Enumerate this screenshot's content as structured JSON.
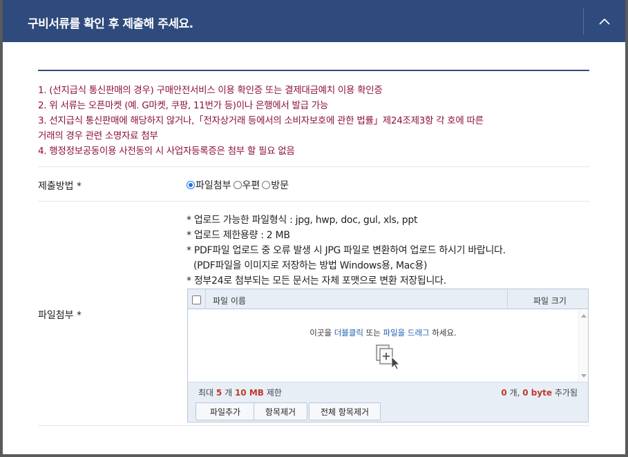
{
  "header": {
    "title": "구비서류를 확인 후 제출해 주세요."
  },
  "notices": [
    "1. (선지급식 통신판매의 경우) 구매안전서비스 이용 확인증 또는 결제대금예치 이용 확인증",
    "2. 위 서류는 오픈마켓 (예. G마켓, 쿠팡, 11번가 등)이나 은행에서 발급 가능",
    "3. 선지급식 통신판매에 해당하지 않거나,「전자상거래 등에서의 소비자보호에 관한 법률」제24조제3항 각 호에 따른",
    "거래의 경우 관련 소명자료 첨부",
    "4. 행정정보공동이용 사전동의 시 사업자등록증은 첨부 할 필요 없음"
  ],
  "submit_method": {
    "label": "제출방법 *",
    "options": [
      "파일첨부",
      "우편",
      "방문"
    ],
    "selected": "파일첨부"
  },
  "file_attach": {
    "label": "파일첨부 *",
    "info": [
      "* 업로드 가능한 파일형식 : jpg, hwp, doc, gul, xls, ppt",
      "* 업로드 제한용량 : 2 MB",
      "* PDF파일 업로드 중 오류 발생 시 JPG 파일로 변환하여 업로드 하시기 바랍니다.",
      "(PDF파일을 이미지로 저장하는 방법  Windows용, Mac용)",
      "* 정부24로 첨부되는 모든 문서는 자체 포맷으로 변환 저장됩니다."
    ]
  },
  "uploader": {
    "col_name": "파일 이름",
    "col_size": "파일 크기",
    "drop_prefix": "이곳을 ",
    "drop_dblclick": "더블클릭",
    "drop_mid": " 또는 ",
    "drop_drag": "파일을 드래그",
    "drop_suffix": " 하세요.",
    "limit_prefix": "최대 ",
    "limit_count": "5",
    "limit_mid": " 개 ",
    "limit_size": "10 MB",
    "limit_suffix": " 제한",
    "added_count": "0",
    "added_mid": " 개, ",
    "added_size": "0 byte",
    "added_suffix": " 추가됨",
    "buttons": {
      "add": "파일추가",
      "remove": "항목제거",
      "remove_all": "전체 항목제거"
    }
  }
}
